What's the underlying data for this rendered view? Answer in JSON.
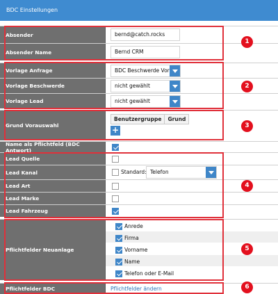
{
  "header": {
    "title": "BDC Einstellungen"
  },
  "fields": {
    "absender": {
      "label": "Absender",
      "value": "bernd@catch.rocks"
    },
    "absender_name": {
      "label": "Absender Name",
      "value": "Bernd CRM"
    },
    "vorlage_anfrage": {
      "label": "Vorlage Anfrage",
      "value": "BDC Beschwerde Vor"
    },
    "vorlage_beschwerde": {
      "label": "Vorlage Beschwerde",
      "value": "nicht gewählt"
    },
    "vorlage_lead": {
      "label": "Vorlage Lead",
      "value": "nicht gewählt"
    },
    "grund_vorauswahl": {
      "label": "Grund Vorauswahl",
      "columns": [
        "Benutzergruppe",
        "Grund"
      ],
      "add": "+"
    },
    "pflichtfeld": {
      "label": "Name als Pflichtfeld (BDC Antwort)",
      "checked": true
    },
    "lead_quelle": {
      "label": "Lead Quelle",
      "checked": false
    },
    "lead_kanal": {
      "label": "Lead Kanal",
      "checked": false,
      "standard_label": "Standard:",
      "standard_value": "Telefon"
    },
    "lead_art": {
      "label": "Lead Art",
      "checked": false
    },
    "lead_marke": {
      "label": "Lead Marke",
      "checked": false
    },
    "lead_fahrzeug": {
      "label": "Lead Fahrzeug",
      "checked": true
    },
    "neuanlage": {
      "label": "Pflichtfelder Neuanlage",
      "items": [
        {
          "label": "Anrede",
          "checked": true
        },
        {
          "label": "Firma",
          "checked": true
        },
        {
          "label": "Vorname",
          "checked": true
        },
        {
          "label": "Name",
          "checked": true
        },
        {
          "label": "Telefon oder E-Mail",
          "checked": true
        }
      ]
    },
    "pflicht_bdc": {
      "label": "Pflichtfelder BDC",
      "link": "Pflichtfelder ändern"
    }
  },
  "badges": [
    "1",
    "2",
    "3",
    "4",
    "5",
    "6"
  ],
  "colors": {
    "header": "#3f8bd0",
    "label_bg": "#6f6f6f",
    "accent": "#3f86c8",
    "highlight": "#e0303a"
  }
}
